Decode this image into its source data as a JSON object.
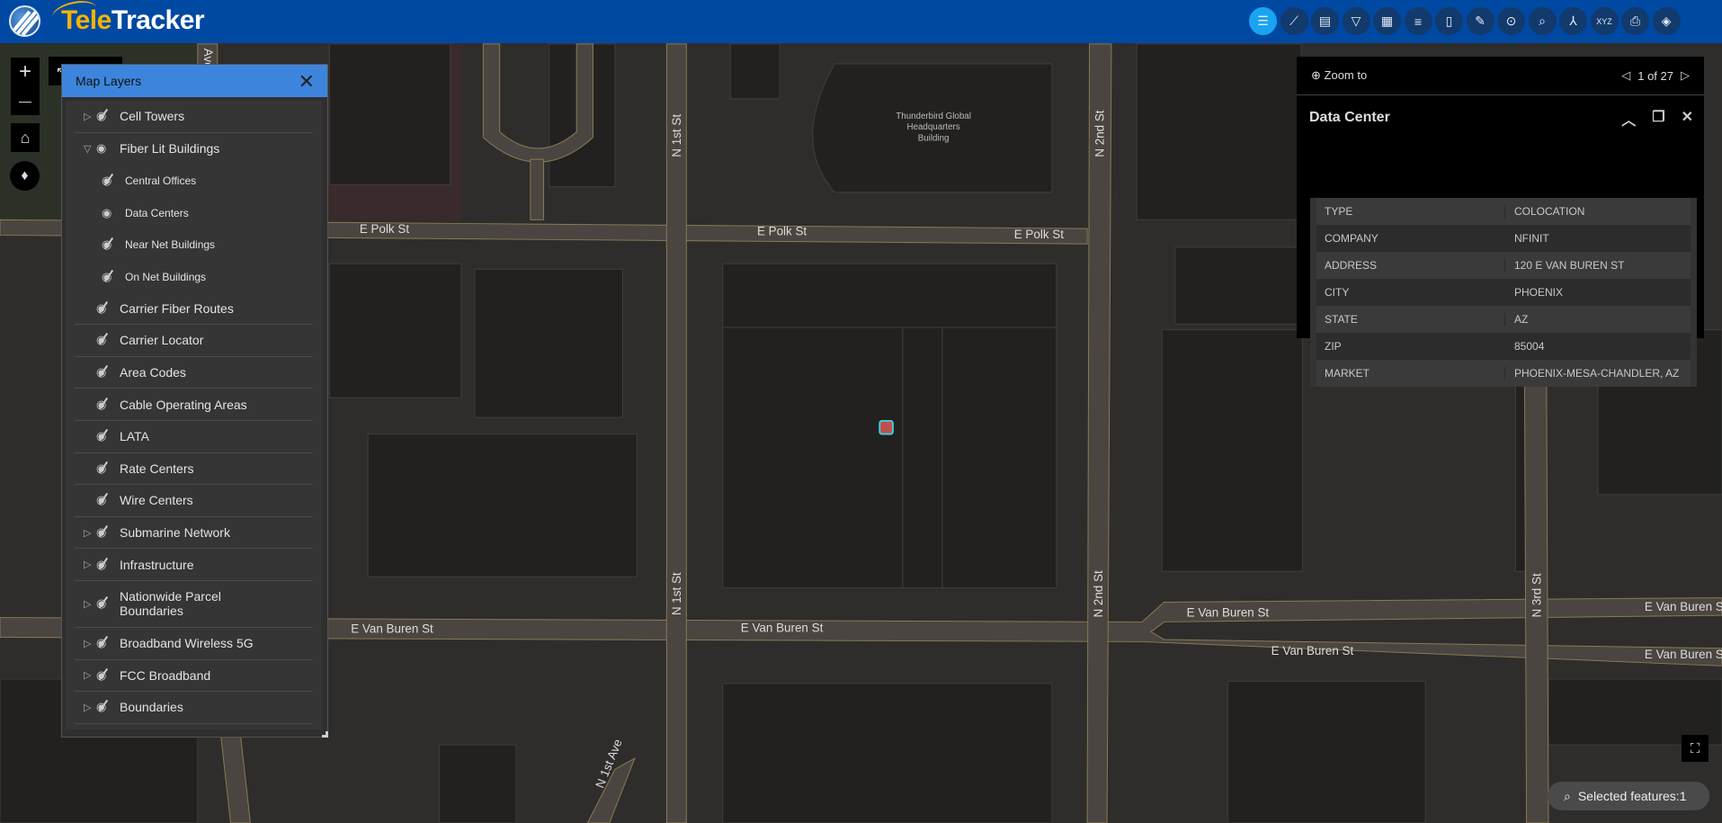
{
  "app": {
    "brand_part1": "Tele",
    "brand_part2": "Tracker"
  },
  "toolbar": [
    "layers-icon",
    "measure-icon",
    "query-icon",
    "filter-icon",
    "table-icon",
    "legend-icon",
    "bookmark-icon",
    "basemap-icon",
    "location-icon",
    "search-icon",
    "coordinate-icon",
    "xyz-icon",
    "print-icon",
    "directions-icon"
  ],
  "map_controls": {
    "zoom_in": "+",
    "zoom_out": "—"
  },
  "map": {
    "labels": {
      "polk1": "E Polk St",
      "polk2": "E Polk St",
      "polk3": "E Polk St",
      "vb1": "E Van Buren St",
      "vb2": "E Van Buren St",
      "vb3": "E Van Buren St",
      "vb4": "E Van Buren St",
      "vb5": "E Van Buren St",
      "vb6": "E Van Buren St",
      "n1a": "N 1st St",
      "n1b": "N 1st St",
      "n2a": "N 2nd St",
      "n2b": "N 2nd St",
      "n3": "N 3rd St",
      "n1ave": "N 1st Ave",
      "ave": "Ave",
      "bldg1": "Thunderbird Global",
      "bldg2": "Headquarters",
      "bldg3": "Building"
    },
    "selected_marker_color": "#c0504d"
  },
  "layers_panel": {
    "title": "Map Layers",
    "items": [
      {
        "label": "Cell Towers",
        "expand": "collapsed",
        "visible": false
      },
      {
        "label": "Fiber Lit Buildings",
        "expand": "expanded",
        "visible": true
      },
      {
        "label": "Central Offices",
        "sub": true,
        "visible": false
      },
      {
        "label": "Data Centers",
        "sub": true,
        "visible": true
      },
      {
        "label": "Near Net Buildings",
        "sub": true,
        "visible": false
      },
      {
        "label": "On Net Buildings",
        "sub": true,
        "visible": false
      },
      {
        "label": "Carrier Fiber Routes",
        "visible": false
      },
      {
        "label": "Carrier Locator",
        "visible": false
      },
      {
        "label": "Area Codes",
        "visible": false
      },
      {
        "label": "Cable Operating Areas",
        "visible": false
      },
      {
        "label": "LATA",
        "visible": false
      },
      {
        "label": "Rate Centers",
        "visible": false
      },
      {
        "label": "Wire Centers",
        "visible": false
      },
      {
        "label": "Submarine Network",
        "expand": "collapsed",
        "visible": false
      },
      {
        "label": "Infrastructure",
        "expand": "collapsed",
        "visible": false
      },
      {
        "label": "Nationwide Parcel Boundaries",
        "expand": "collapsed",
        "visible": false
      },
      {
        "label": "Broadband Wireless 5G",
        "expand": "collapsed",
        "visible": false
      },
      {
        "label": "FCC Broadband",
        "expand": "collapsed",
        "visible": false
      },
      {
        "label": "Boundaries",
        "expand": "collapsed",
        "visible": false
      }
    ]
  },
  "popup": {
    "zoom_to": "Zoom to",
    "pager": "1 of 27",
    "title": "Data Center",
    "fields": [
      {
        "k": "TYPE",
        "v": "COLOCATION"
      },
      {
        "k": "COMPANY",
        "v": "NFINIT"
      },
      {
        "k": "ADDRESS",
        "v": "120 E VAN BUREN ST"
      },
      {
        "k": "CITY",
        "v": "PHOENIX"
      },
      {
        "k": "STATE",
        "v": "AZ"
      },
      {
        "k": "ZIP",
        "v": "85004"
      },
      {
        "k": "MARKET",
        "v": "PHOENIX-MESA-CHANDLER, AZ"
      }
    ]
  },
  "status": {
    "selected": "Selected features:1"
  }
}
